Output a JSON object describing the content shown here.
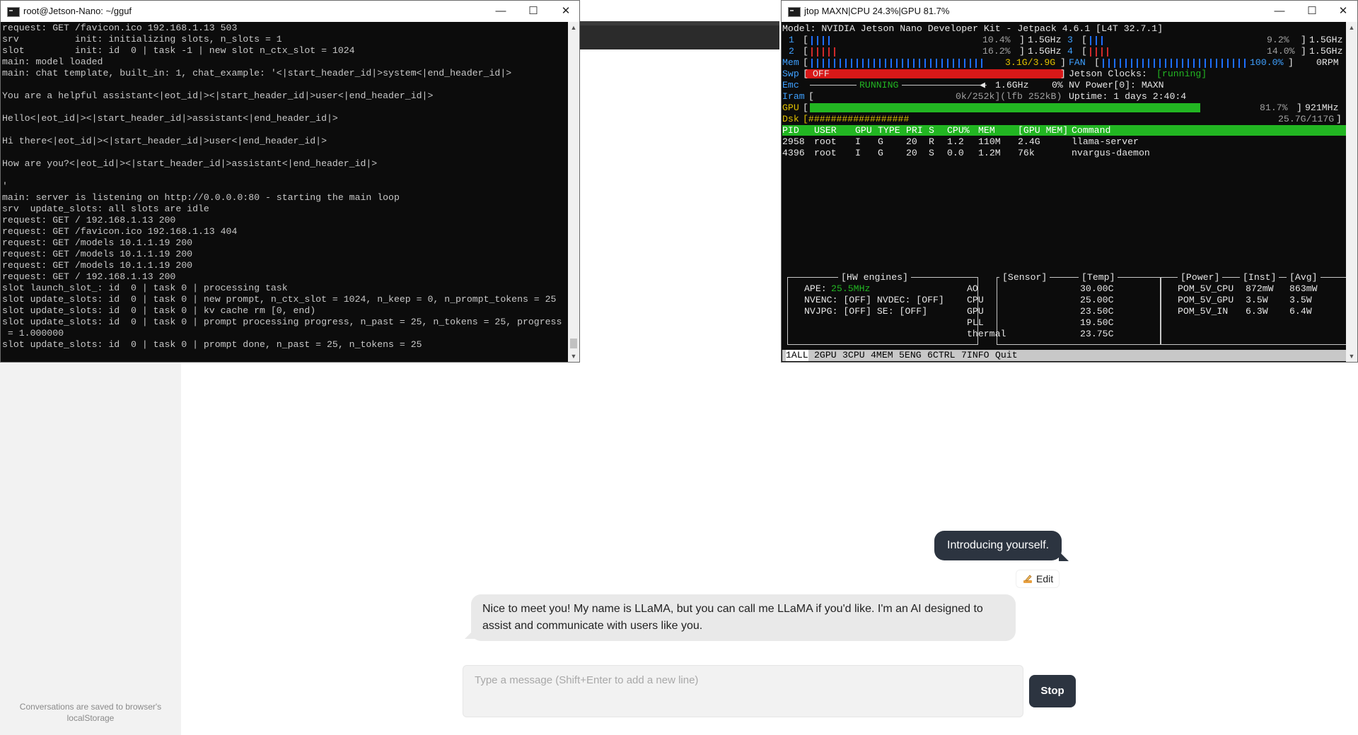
{
  "chat": {
    "sidebar_note": "Conversations are saved to browser's localStorage",
    "user_message": "Introducing yourself.",
    "edit_label": "Edit",
    "assistant_message": "Nice to meet you! My name is LLaMA, but you can call me LLaMA if you'd like. I'm an AI designed to assist and communicate with users like you.",
    "composer_placeholder": "Type a message (Shift+Enter to add a new line)",
    "stop_label": "Stop"
  },
  "server_window": {
    "title": "root@Jetson-Nano: ~/gguf",
    "lines": [
      "request: GET /favicon.ico 192.168.1.13 503",
      "srv          init: initializing slots, n_slots = 1",
      "slot         init: id  0 | task -1 | new slot n_ctx_slot = 1024",
      "main: model loaded",
      "main: chat template, built_in: 1, chat_example: '<|start_header_id|>system<|end_header_id|>",
      "",
      "You are a helpful assistant<|eot_id|><|start_header_id|>user<|end_header_id|>",
      "",
      "Hello<|eot_id|><|start_header_id|>assistant<|end_header_id|>",
      "",
      "Hi there<|eot_id|><|start_header_id|>user<|end_header_id|>",
      "",
      "How are you?<|eot_id|><|start_header_id|>assistant<|end_header_id|>",
      "",
      "'",
      "main: server is listening on http://0.0.0.0:80 - starting the main loop",
      "srv  update_slots: all slots are idle",
      "request: GET / 192.168.1.13 200",
      "request: GET /favicon.ico 192.168.1.13 404",
      "request: GET /models 10.1.1.19 200",
      "request: GET /models 10.1.1.19 200",
      "request: GET /models 10.1.1.19 200",
      "request: GET / 192.168.1.13 200",
      "slot launch_slot_: id  0 | task 0 | processing task",
      "slot update_slots: id  0 | task 0 | new prompt, n_ctx_slot = 1024, n_keep = 0, n_prompt_tokens = 25",
      "slot update_slots: id  0 | task 0 | kv cache rm [0, end)",
      "slot update_slots: id  0 | task 0 | prompt processing progress, n_past = 25, n_tokens = 25, progress",
      " = 1.000000",
      "slot update_slots: id  0 | task 0 | prompt done, n_past = 25, n_tokens = 25"
    ]
  },
  "jtop_window": {
    "title": "jtop MAXN|CPU 24.3%|GPU 81.7%",
    "model_line": "Model: NVIDIA Jetson Nano Developer Kit - Jetpack 4.6.1 [L4T 32.7.1]",
    "cpu": [
      {
        "id": "1",
        "pct": "10.4%",
        "freq": "1.5GHz",
        "level": 0.104
      },
      {
        "id": "2",
        "pct": "16.2%",
        "freq": "1.5GHz",
        "level": 0.162
      },
      {
        "id": "3",
        "pct": "9.2%",
        "freq": "1.5GHz",
        "level": 0.092
      },
      {
        "id": "4",
        "pct": "14.0%",
        "freq": "1.5GHz",
        "level": 0.14
      }
    ],
    "mem": {
      "label": "Mem",
      "value": "3.1G/3.9G",
      "level": 0.79
    },
    "fan": {
      "label": "FAN",
      "pct": "100.0%",
      "rpm": "0RPM",
      "level": 1.0
    },
    "swp": {
      "label": "Swp",
      "value": "OFF"
    },
    "jetson_clocks": {
      "label": "Jetson Clocks:",
      "value": "[running]"
    },
    "emc": {
      "label": "Emc",
      "status": "RUNNING",
      "freq": "1.6GHz",
      "pct": "0%"
    },
    "nvpower": "NV Power[0]: MAXN",
    "iram": {
      "label": "Iram",
      "value": "0k/252k](lfb 252kB)"
    },
    "uptime": "Uptime: 1 days 2:40:4",
    "gpu": {
      "label": "GPU",
      "pct": "81.7%",
      "freq": "921MHz",
      "level": 0.817
    },
    "dsk": {
      "label": "Dsk",
      "bar": "[##################",
      "value": "25.7G/117G"
    },
    "process_header": [
      "PID",
      "USER",
      "GPU",
      "TYPE",
      "PRI",
      "S",
      "CPU%",
      "MEM",
      "[GPU MEM]",
      "Command"
    ],
    "processes": [
      [
        "2958",
        "root",
        "I",
        "G",
        "20",
        "R",
        "1.2",
        "110M",
        "2.4G",
        "llama-server"
      ],
      [
        "4396",
        "root",
        "I",
        "G",
        "20",
        "S",
        "0.0",
        "1.2M",
        "76k",
        "nvargus-daemon"
      ]
    ],
    "hw_engines": {
      "title": "[HW engines]",
      "ape_label": "APE:",
      "ape_value": "25.5MHz",
      "row2": "NVENC: [OFF] NVDEC: [OFF]",
      "row3": "NVJPG: [OFF] SE: [OFF]"
    },
    "sensors": {
      "titles": [
        "[Sensor]",
        "[Temp]"
      ],
      "rows": [
        [
          "AO",
          "30.00C"
        ],
        [
          "CPU",
          "25.00C"
        ],
        [
          "GPU",
          "23.50C"
        ],
        [
          "PLL",
          "19.50C"
        ],
        [
          "thermal",
          "23.75C"
        ]
      ]
    },
    "power": {
      "titles": [
        "[Power]",
        "[Inst]",
        "[Avg]"
      ],
      "rows": [
        [
          "POM_5V_CPU",
          "872mW",
          "863mW"
        ],
        [
          "POM_5V_GPU",
          "3.5W",
          "3.5W"
        ],
        [
          "POM_5V_IN",
          "6.3W",
          "6.4W"
        ]
      ]
    },
    "tabs": [
      "1ALL",
      "2GPU",
      "3CPU",
      "4MEM",
      "5ENG",
      "6CTRL",
      "7INFO",
      "Quit"
    ]
  },
  "colors": {
    "accent_dark": "#2c3440",
    "term_bg": "#0c0c0c",
    "jtop_green": "#22b622",
    "jtop_red": "#e03030",
    "jtop_blue": "#3ea0ff"
  }
}
